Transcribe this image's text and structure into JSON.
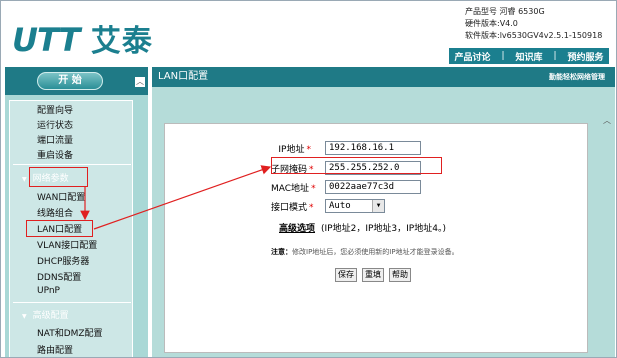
{
  "header": {
    "logo_latin": "UTT",
    "logo_cn": "艾泰",
    "product_model": "产品型号 河睿 6530G",
    "hardware_version": "硬件版本:V4.0",
    "software_version": "软件版本:lv6530GV4v2.5.1-150918",
    "links": [
      "产品讨论",
      "知识库",
      "预约服务"
    ],
    "link_separator": "|"
  },
  "sidebar": {
    "start_label": "开 始",
    "items": [
      {
        "label": "配置向导"
      },
      {
        "label": "运行状态"
      },
      {
        "label": "端口流量"
      },
      {
        "label": "重启设备"
      }
    ],
    "group_network": "网络参数",
    "network_items": [
      {
        "label": "WAN口配置"
      },
      {
        "label": "线路组合"
      },
      {
        "label": "LAN口配置"
      },
      {
        "label": "VLAN接口配置"
      },
      {
        "label": "DHCP服务器"
      },
      {
        "label": "DDNS配置"
      },
      {
        "label": "UPnP"
      }
    ],
    "group_advanced": "高级配置",
    "advanced_items": [
      {
        "label": "NAT和DMZ配置"
      },
      {
        "label": "路由配置"
      }
    ]
  },
  "content": {
    "title": "LAN口配置",
    "title_right": "勤能轻松网络管理",
    "form": {
      "ip_label": "IP地址",
      "ip_value": "192.168.16.1",
      "mask_label": "子网掩码",
      "mask_value": "255.255.252.0",
      "mac_label": "MAC地址",
      "mac_value": "0022aae77c3d",
      "mode_label": "接口模式",
      "mode_value": "Auto",
      "required_mark": "*"
    },
    "advanced_label": "高级选项",
    "advanced_desc": "(IP地址2，IP地址3，IP地址4。)",
    "note_label": "注意：",
    "note_text": "修改IP地址后，您必须使用新的IP地址才能登录设备。",
    "buttons": {
      "save": "保存",
      "reset": "重填",
      "help": "帮助"
    }
  },
  "colors": {
    "brand_teal": "#1f7a86",
    "sidebar_bg": "#a9d8d6",
    "content_bg": "#b5dcd9",
    "annotation_red": "#e02020"
  }
}
